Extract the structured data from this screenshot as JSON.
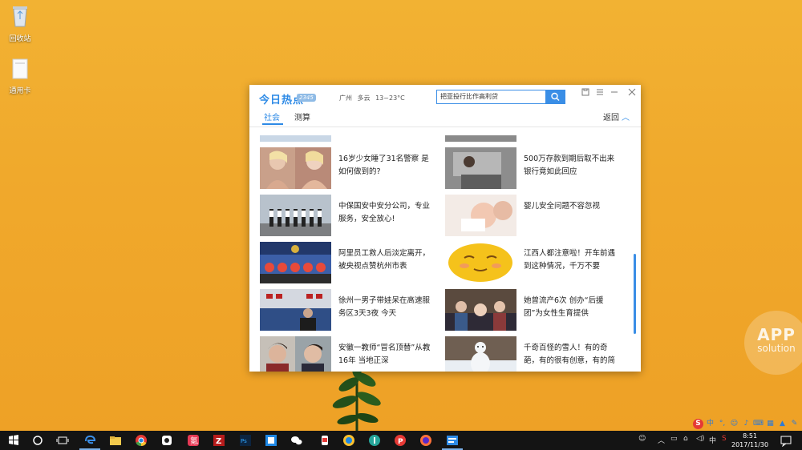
{
  "desktop": {
    "icons": [
      {
        "label": "回收站",
        "icon": "recycle-bin-icon"
      },
      {
        "label": "通用卡",
        "icon": "folder-icon"
      }
    ],
    "watermark": {
      "line1": "APP",
      "line2": "solution"
    }
  },
  "window": {
    "logo": "今日热点",
    "logo_badge": "2345",
    "weather": {
      "city": "广州",
      "condition": "多云",
      "temp": "13~23°C"
    },
    "search": {
      "value": "把亚投行比作高利贷"
    },
    "tabs": [
      {
        "label": "社会",
        "active": true
      },
      {
        "label": "测算",
        "active": false
      }
    ],
    "back_label": "返回",
    "news": [
      {
        "title": "16岁少女睡了31名警察 是如何做到的?"
      },
      {
        "title": "500万存款到期后取不出来 银行竟如此回应"
      },
      {
        "title": "中保国安中安分公司，专业服务，安全放心!"
      },
      {
        "title": "婴儿安全问题不容忽视"
      },
      {
        "title": "阿里员工救人后淡定离开，被央视点赞杭州市表"
      },
      {
        "title": "江西人都注意啦！开车前遇到这种情况，千万不要"
      },
      {
        "title": "徐州一男子带娃呆在高速服务区3天3夜 今天"
      },
      {
        "title": "她曾流产6次 创办“后援团”为女性生育提供"
      },
      {
        "title": "安徽一教师“冒名顶替”从教16年 当地正深"
      },
      {
        "title": "千奇百怪的雪人！有的奇葩，有的很有创意，有的简"
      }
    ]
  },
  "taskbar": {
    "apps": [
      "start-icon",
      "cortana-icon",
      "task-view-icon",
      "edge-icon",
      "file-explorer-icon",
      "chrome-icon",
      "app-icon",
      "app-icon",
      "filezilla-icon",
      "photoshop-icon",
      "app-icon",
      "wechat-icon",
      "app-icon",
      "app-icon",
      "app-icon",
      "app-icon",
      "firefox-icon",
      "app-icon"
    ],
    "ime": "中",
    "ime_lang": "中",
    "time": "8:51",
    "date": "2017/11/30"
  },
  "colors": {
    "accent": "#2d8ae6",
    "desktop": "#f0a92c",
    "taskbar": "#141414"
  }
}
